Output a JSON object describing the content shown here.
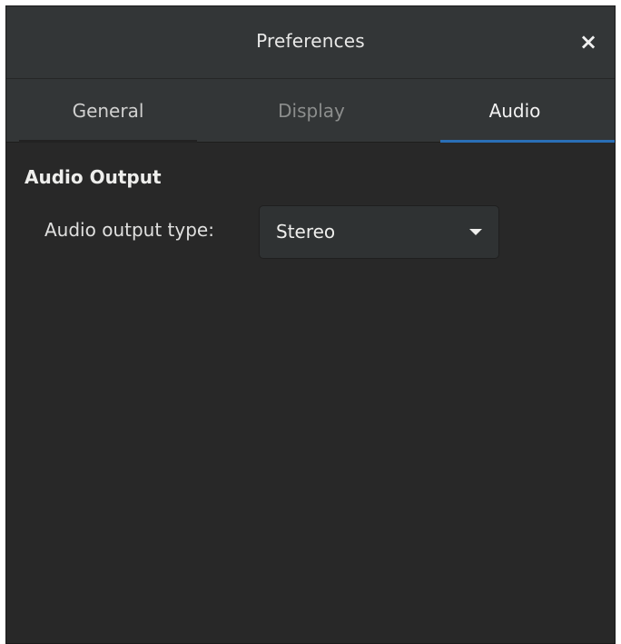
{
  "window": {
    "title": "Preferences",
    "close_symbol": "×"
  },
  "tabs": [
    {
      "label": "General",
      "active": false
    },
    {
      "label": "Display",
      "active": false
    },
    {
      "label": "Audio",
      "active": true
    }
  ],
  "audio": {
    "section_title": "Audio Output",
    "output_type_label": "Audio output type:",
    "output_type_value": "Stereo"
  },
  "colors": {
    "accent": "#2a6fb6",
    "background": "#282828",
    "headerbar": "#333637"
  },
  "icons": {
    "close": "close-icon",
    "dropdown": "chevron-down-icon"
  }
}
